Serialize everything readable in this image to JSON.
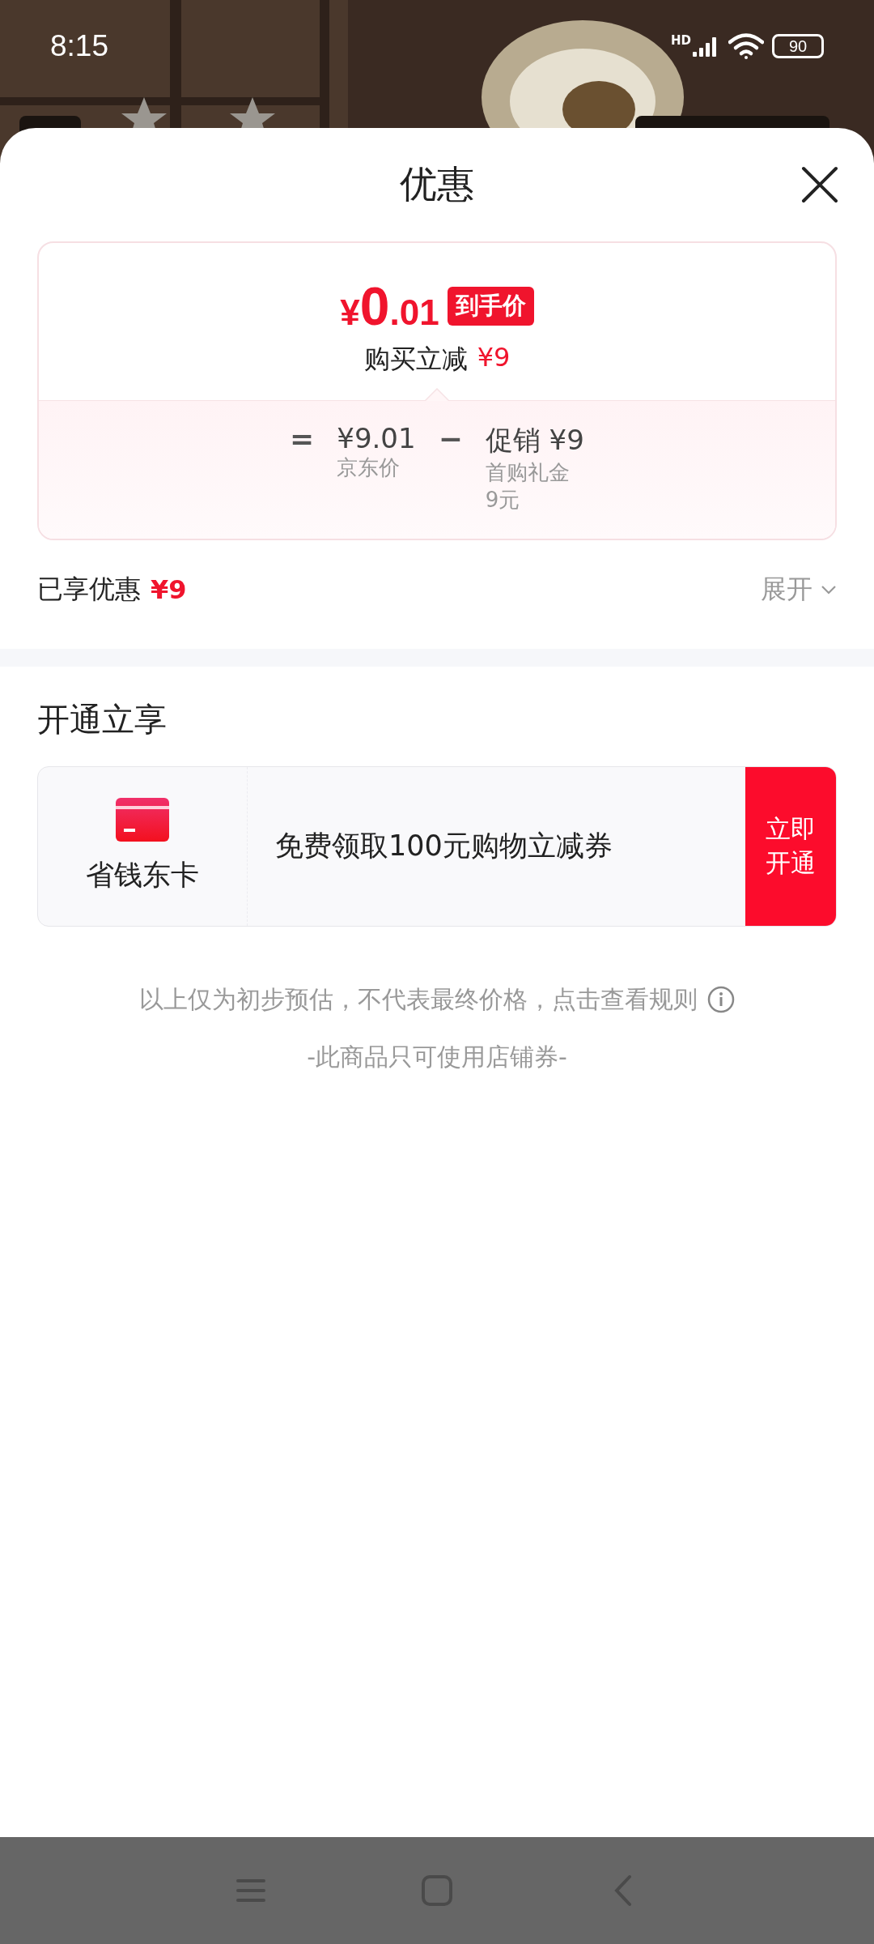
{
  "status_bar": {
    "time": "8:15",
    "network": "HD",
    "battery": "90"
  },
  "sheet": {
    "title": "优惠"
  },
  "price_card": {
    "price": {
      "currency": "¥",
      "integer": "0",
      "decimal": ".01"
    },
    "badge": "到手价",
    "reduction_label": "购买立减",
    "reduction_amount": "¥9",
    "breakdown": [
      {
        "kind": "operator",
        "text": "="
      },
      {
        "kind": "term",
        "amount": "¥9.01",
        "notes": [
          "京东价"
        ]
      },
      {
        "kind": "operator",
        "text": "−"
      },
      {
        "kind": "term",
        "amount": "促销 ¥9",
        "notes": [
          "首购礼金",
          "9元"
        ]
      }
    ]
  },
  "savings": {
    "label": "已享优惠",
    "amount": "¥9",
    "expand": "展开"
  },
  "membership": {
    "title": "开通立享",
    "card_name": "省钱东卡",
    "offer": "免费领取100元购物立减券",
    "button": "立即开通"
  },
  "disclaimer": "以上仅为初步预估，不代表最终价格，点击查看规则",
  "coupon_note": "-此商品只可使用店铺券-"
}
